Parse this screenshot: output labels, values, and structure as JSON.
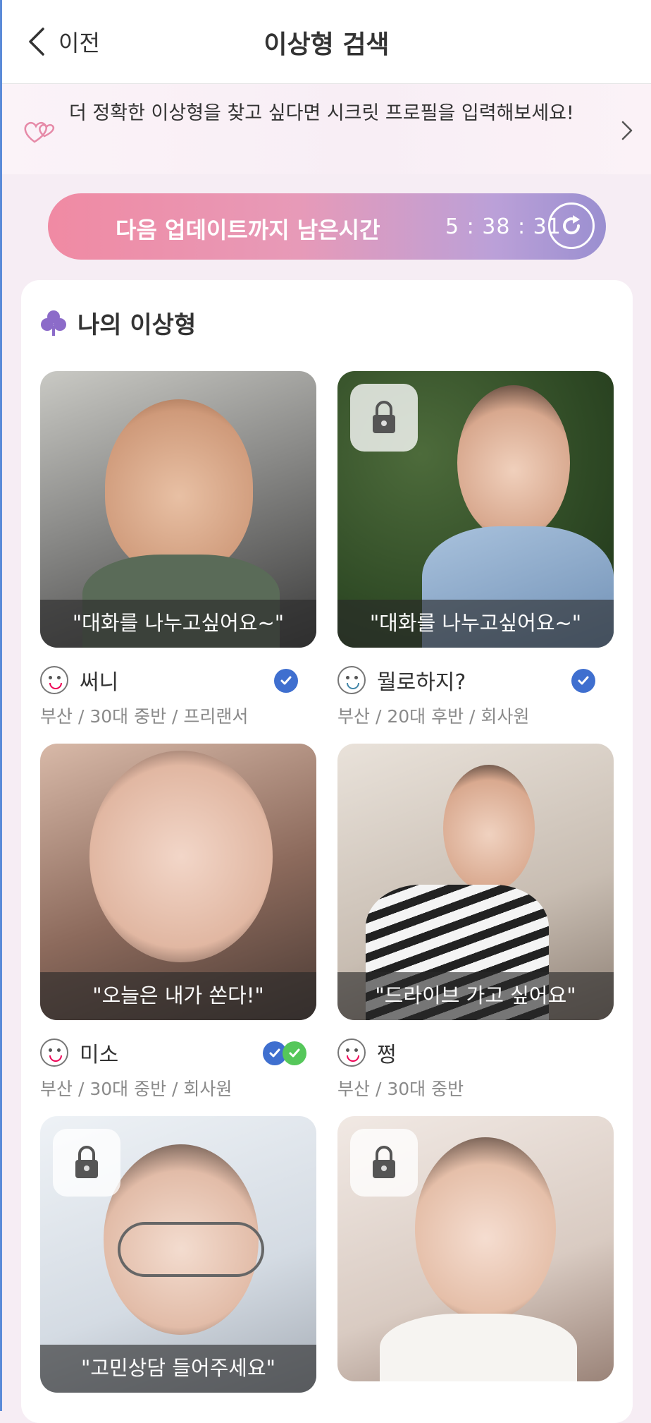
{
  "header": {
    "back_label": "이전",
    "title": "이상형 검색"
  },
  "banner": {
    "text": "더 정확한 이상형을 찾고 싶다면 시크릿 프로필을 입력해보세요!"
  },
  "timer": {
    "label": "다음 업데이트까지 남은시간",
    "value": "5 : 38 : 31"
  },
  "section": {
    "title": "나의 이상형"
  },
  "profiles": [
    {
      "quote": "\"대화를 나누고싶어요~\"",
      "name": "써니",
      "meta": "부산 / 30대 중반 / 프리랜서"
    },
    {
      "quote": "\"대화를 나누고싶어요~\"",
      "name": "뭘로하지?",
      "meta": "부산 / 20대 후반 / 회사원"
    },
    {
      "quote": "\"오늘은 내가 쏜다!\"",
      "name": "미소",
      "meta": "부산 / 30대 중반 / 회사원"
    },
    {
      "quote": "\"드라이브 가고 싶어요\"",
      "name": "쩡",
      "meta": "부산 / 30대 중반"
    },
    {
      "quote": "\"고민상담 들어주세요\"",
      "name": "",
      "meta": ""
    },
    {
      "quote": "",
      "name": "",
      "meta": ""
    }
  ],
  "colors": {
    "accent_blue": "#3f6fcf",
    "accent_green": "#55c75a",
    "clover": "#8c6bc9"
  }
}
